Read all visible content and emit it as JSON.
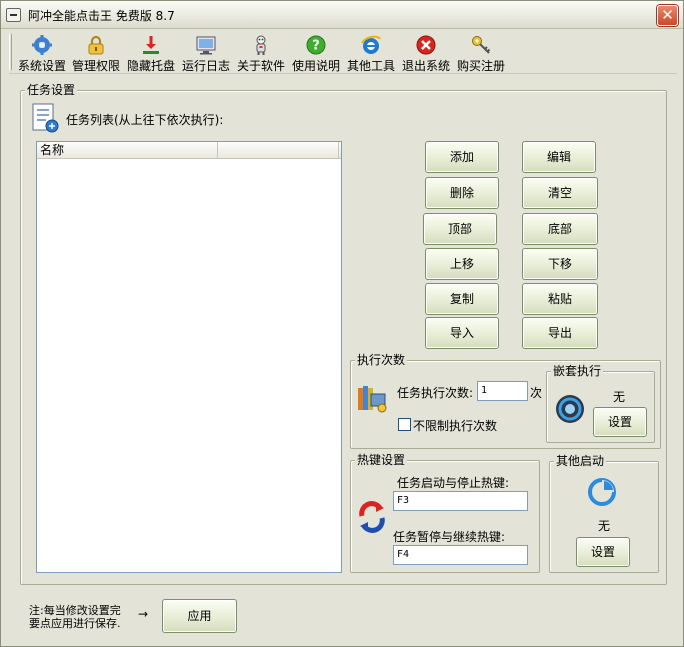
{
  "window": {
    "title": "阿冲全能点击王 免费版 8.7"
  },
  "toolbar": {
    "items": [
      {
        "label": "系统设置",
        "icon": "settings-gear-icon"
      },
      {
        "label": "管理权限",
        "icon": "lock-icon"
      },
      {
        "label": "隐藏托盘",
        "icon": "download-tray-icon"
      },
      {
        "label": "运行日志",
        "icon": "log-monitor-icon"
      },
      {
        "label": "关于软件",
        "icon": "robot-icon"
      },
      {
        "label": "使用说明",
        "icon": "help-icon"
      },
      {
        "label": "其他工具",
        "icon": "ie-browser-icon"
      },
      {
        "label": "退出系统",
        "icon": "exit-icon"
      },
      {
        "label": "购买注册",
        "icon": "key-icon"
      }
    ]
  },
  "task_settings": {
    "legend": "任务设置",
    "list_label": "任务列表(从上往下依次执行):",
    "list_columns": [
      "名称",
      ""
    ],
    "rows": []
  },
  "actions": {
    "add": "添加",
    "edit": "编辑",
    "delete": "删除",
    "clear": "清空",
    "top": "顶部",
    "bottom": "底部",
    "up": "上移",
    "down": "下移",
    "copy": "复制",
    "paste": "粘贴",
    "import": "导入",
    "export": "导出"
  },
  "exec_count": {
    "legend": "执行次数",
    "label": "任务执行次数:",
    "value": "1",
    "unit": "次",
    "unlimited_label": "不限制执行次数",
    "unlimited_checked": false
  },
  "nested": {
    "legend": "嵌套执行",
    "value": "无",
    "button": "设置"
  },
  "hotkey": {
    "legend": "热键设置",
    "start_stop_label": "任务启动与停止热键:",
    "start_stop_value": "F3",
    "pause_label": "任务暂停与继续热键:",
    "pause_value": "F4"
  },
  "other_start": {
    "legend": "其他启动",
    "value": "无",
    "button": "设置"
  },
  "footer": {
    "note_line1": "注:每当修改设置完",
    "note_line2": "要点应用进行保存.",
    "arrow": "→",
    "apply": "应用"
  },
  "colors": {
    "accent_green": "#7a8f66",
    "close_red": "#c94a28",
    "window_bg": "#e3e3d8"
  }
}
